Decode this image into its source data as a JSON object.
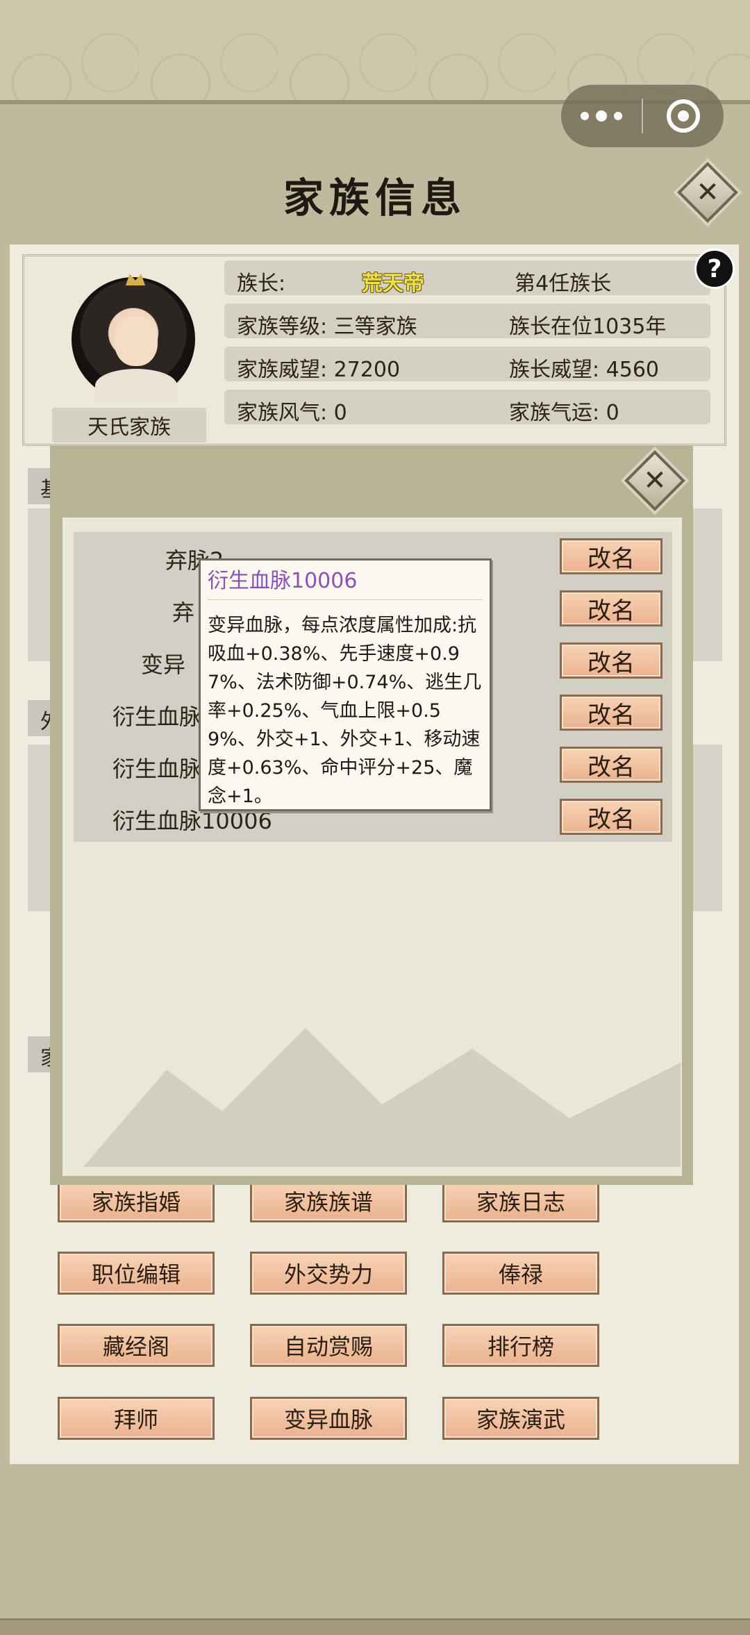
{
  "window": {
    "title": "家族信息",
    "close_glyph": "✕"
  },
  "capsule": {
    "more_icon": "more-dots-icon",
    "exit_icon": "target-icon"
  },
  "header": {
    "help_glyph": "?",
    "family_name": "天氏家族",
    "rows": [
      {
        "left_label": "族长:",
        "name": "荒天帝",
        "right": "第4任族长"
      },
      {
        "left": "家族等级: 三等家族",
        "right": "族长在位1035年"
      },
      {
        "left": "家族威望: 27200",
        "right": "族长威望: 4560"
      },
      {
        "left": "家族风气: 0",
        "right": "家族气运: 0"
      }
    ]
  },
  "sections": {
    "basic_tab": "基",
    "foreign_tab": "外",
    "family_tab": "家"
  },
  "function_buttons": [
    [
      "家族指婚",
      "家族族谱",
      "家族日志"
    ],
    [
      "职位编辑",
      "外交势力",
      "俸禄"
    ],
    [
      "藏经阁",
      "自动赏赐",
      "排行榜"
    ],
    [
      "拜师",
      "变异血脉",
      "家族演武"
    ]
  ],
  "dialog": {
    "close_glyph": "✕",
    "rename_label": "改名",
    "lineages": [
      {
        "visible_text": "弃脉2"
      },
      {
        "visible_text": "弃"
      },
      {
        "visible_text": "变异"
      },
      {
        "visible_text": "衍生血脉"
      },
      {
        "visible_text": "衍生血脉"
      },
      {
        "visible_text": "衍生血脉10006"
      }
    ]
  },
  "tooltip": {
    "title": "衍生血脉10006",
    "body": "变异血脉，每点浓度属性加成:抗吸血+0.38%、先手速度+0.97%、法术防御+0.74%、逃生几率+0.25%、气血上限+0.59%、外交+1、外交+1、移动速度+0.63%、命中评分+25、魔念+1。"
  },
  "colors": {
    "background": "#c1b99d",
    "card": "#eeebdf",
    "button": "#ebb28f",
    "tooltip_title": "#8a52b8",
    "leader_name": "#f0e04a"
  }
}
